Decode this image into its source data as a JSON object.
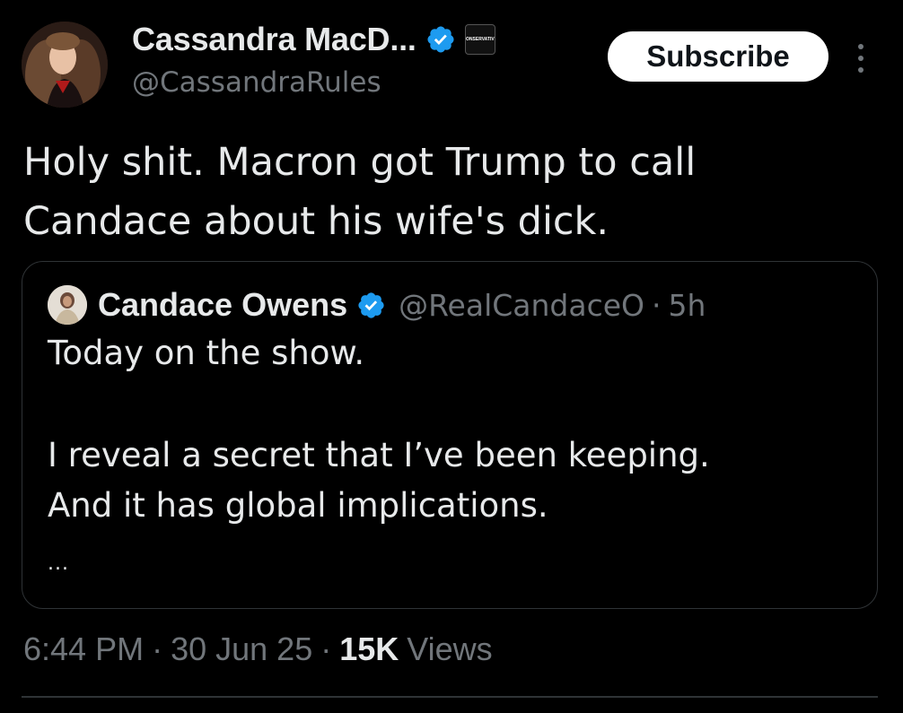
{
  "author": {
    "display_name": "Cassandra MacD...",
    "handle": "@CassandraRules",
    "affiliation_badge": "CONSERVATIVE",
    "verified": true
  },
  "actions": {
    "subscribe_label": "Subscribe",
    "more_icon": "more-vertical-icon"
  },
  "post": {
    "lines": [
      "Holy shit. Macron got Trump to call",
      "Candace about his wife's dick."
    ]
  },
  "quoted": {
    "display_name": "Candace Owens",
    "handle": "@RealCandaceO",
    "separator": "·",
    "time": "5h",
    "verified": true,
    "lines": [
      "Today on the show.",
      "I reveal a secret that I’ve been keeping.",
      "And it has global implications.",
      "..."
    ]
  },
  "meta": {
    "time": "6:44 PM",
    "separator": "·",
    "date": "30 Jun 25",
    "views_count": "15K",
    "views_label": "Views"
  },
  "colors": {
    "background": "#000000",
    "text_primary": "#e7e9ea",
    "text_secondary": "#71767b",
    "verified_badge": "#1d9bf0",
    "border": "#2f3336",
    "subscribe_bg": "#ffffff"
  }
}
